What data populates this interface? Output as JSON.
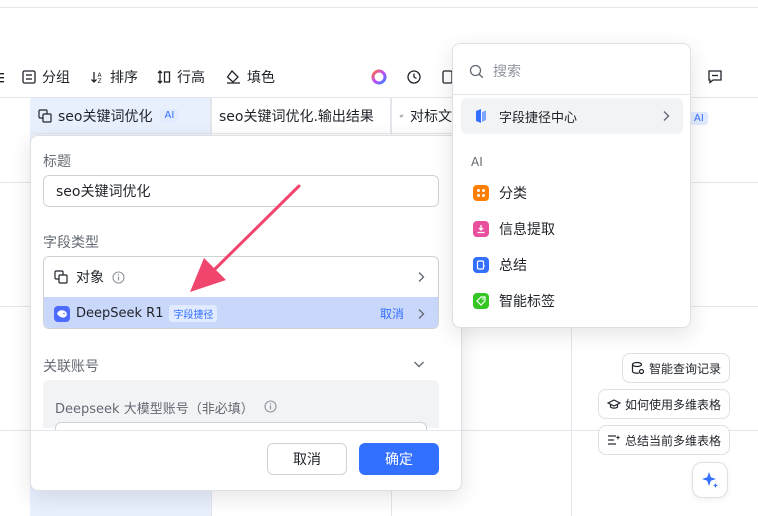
{
  "toolbar": {
    "group_label": "分组",
    "sort_label": "排序",
    "row_height_label": "行高",
    "fill_label": "填色"
  },
  "table": {
    "headers": [
      {
        "label": "seo关键词优化",
        "tag": "AI"
      },
      {
        "label": "seo关键词优化.输出结果"
      },
      {
        "label": "对标文"
      },
      {
        "tag": "AI"
      }
    ]
  },
  "field_panel": {
    "title_label": "标题",
    "title_value": "seo关键词优化",
    "type_label": "字段类型",
    "type_option": "对象",
    "selected_model": "DeepSeek R1",
    "selected_tag": "字段捷径",
    "cancel_link": "取消",
    "account_label": "关联账号",
    "account_field_label": "Deepseek 大模型账号（非必填）",
    "cancel_button": "取消",
    "confirm_button": "确定"
  },
  "menu": {
    "search_placeholder": "搜索",
    "shortcut_center": "字段捷径中心",
    "section_ai": "AI",
    "items": [
      {
        "label": "分类",
        "color": "#ff7d00"
      },
      {
        "label": "信息提取",
        "color": "#e84f9c"
      },
      {
        "label": "总结",
        "color": "#3370ff"
      },
      {
        "label": "智能标签",
        "color": "#34c724"
      }
    ]
  },
  "chips": {
    "query_history": "智能查询记录",
    "how_to_use": "如何使用多维表格",
    "summarize": "总结当前多维表格"
  },
  "colors": {
    "accent": "#3370ff",
    "selected_bg": "#c9d7fb",
    "arrow": "#f0466e"
  }
}
